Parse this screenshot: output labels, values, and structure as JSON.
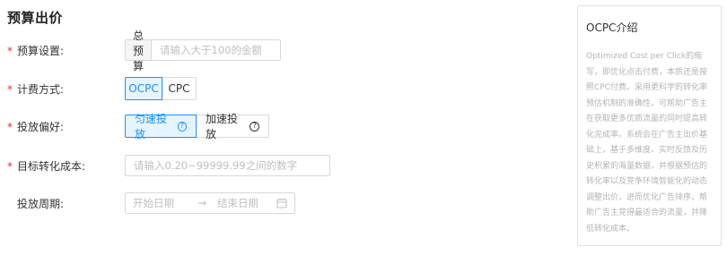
{
  "section": {
    "title": "预算出价"
  },
  "budget": {
    "label": "预算设置:",
    "addon": "总预算",
    "placeholder": "请输入大于100的金额"
  },
  "billing": {
    "label": "计费方式:",
    "options": [
      "OCPC",
      "CPC"
    ],
    "selected": "OCPC"
  },
  "delivery": {
    "label": "投放偏好:",
    "options": [
      "匀速投放",
      "加速投放"
    ],
    "selected": "匀速投放",
    "help_glyph": "?"
  },
  "target_cost": {
    "label": "目标转化成本:",
    "placeholder": "请输入0.20~99999.99之间的数字"
  },
  "period": {
    "label": "投放周期:",
    "start_placeholder": "开始日期",
    "separator": "→",
    "end_placeholder": "结束日期"
  },
  "required_mark": "*",
  "info_panel": {
    "title": "OCPC介绍",
    "body": "Optimized Cost per Click的缩写，即优化点击付费，本质还是按照CPC付费。采用更科学的转化率预估机制的准确性，可帮助广告主在获取更多优质流量的同时提高转化完成率。系统会在广告主出价基础上，基于多维度、实时反馈及历史积累的海量数据，并根据预估的转化率以及竞争环境智能化的动态调整出价，进而优化广告排序，帮助广告主竞得最适合的流量，并降低转化成本。"
  },
  "colors": {
    "accent": "#1890ff",
    "required": "#f5222d",
    "border": "#d9d9d9",
    "placeholder": "#bfbfbf"
  }
}
